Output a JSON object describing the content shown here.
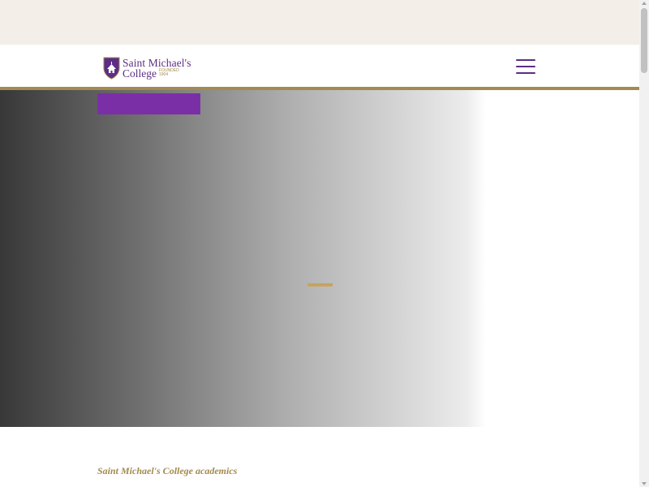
{
  "header": {
    "logo": {
      "line1": "Saint Michael's",
      "line2": "College",
      "founded_label": "FOUNDED",
      "founded_year": "1904"
    },
    "menu_icon": "hamburger-icon"
  },
  "hero": {
    "button_label": ""
  },
  "main": {
    "section_title": "Saint Michael's College academics"
  },
  "colors": {
    "brand_purple": "#5c2d85",
    "button_purple": "#7b2fa6",
    "gold": "#a38a4e",
    "accent_gold": "#c8a35f",
    "utility_bar": "#f3efe8"
  }
}
